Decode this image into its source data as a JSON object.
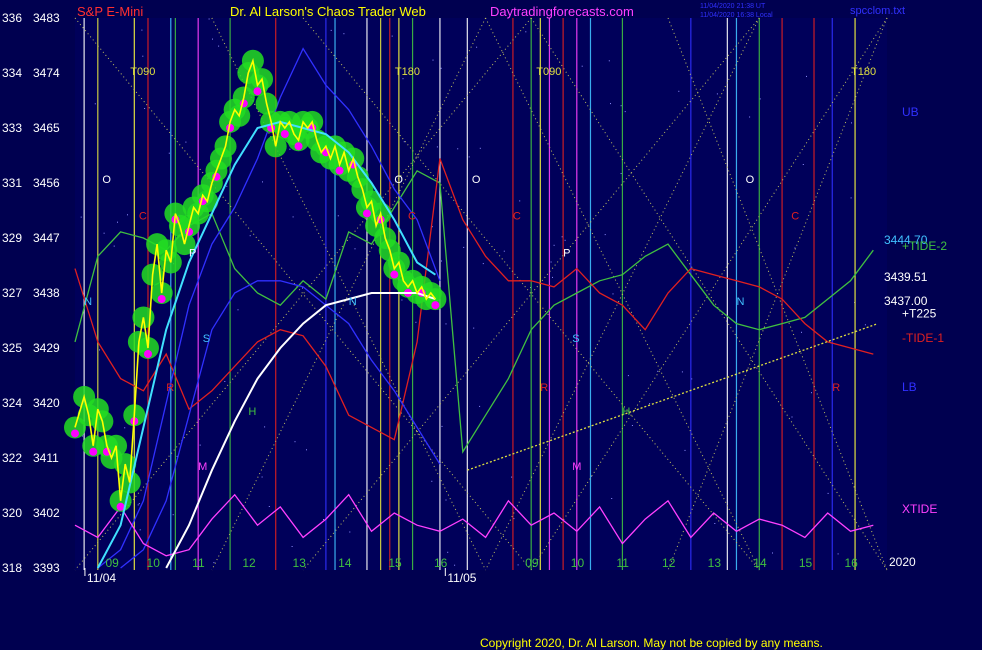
{
  "header": {
    "left_title": "S&P E-Mini",
    "center_title": "Dr. Al Larson's Chaos Trader Web",
    "site": "Daytradingforecasts.com",
    "stamp1": "11/04/2020 21:38 UT",
    "stamp2": "11/04/2020 16:38 Local",
    "filename": "spcclom.txt"
  },
  "footer": {
    "copyright": "Copyright 2020, Dr. Al Larson. May not be copied by any means."
  },
  "colors": {
    "background": "#000050",
    "plot_bg": "#00005a",
    "price": "#ffff00",
    "cyan_ma": "#40e0ff",
    "white_ma": "#ffffff",
    "green_glow": "#22dd22",
    "magenta": "#ff00ff",
    "tide1": "#e02020",
    "tide2": "#40c040",
    "band": "#3030ff"
  },
  "chart_data": {
    "type": "line",
    "ylim": [
      3393,
      3483
    ],
    "y_ticks": [
      {
        "left": "336",
        "right": "3483",
        "v": 3483
      },
      {
        "left": "334",
        "right": "3474",
        "v": 3474
      },
      {
        "left": "333",
        "right": "3465",
        "v": 3465
      },
      {
        "left": "331",
        "right": "3456",
        "v": 3456
      },
      {
        "left": "329",
        "right": "3447",
        "v": 3447
      },
      {
        "left": "327",
        "right": "3438",
        "v": 3438
      },
      {
        "left": "325",
        "right": "3429",
        "v": 3429
      },
      {
        "left": "324",
        "right": "3420",
        "v": 3420
      },
      {
        "left": "322",
        "right": "3411",
        "v": 3411
      },
      {
        "left": "320",
        "right": "3402",
        "v": 3402
      },
      {
        "left": "318",
        "right": "3393",
        "v": 3393
      }
    ],
    "hour_ticks": [
      {
        "label": "09",
        "t": 0.08
      },
      {
        "label": "10",
        "t": 0.17
      },
      {
        "label": "11",
        "t": 0.27
      },
      {
        "label": "12",
        "t": 0.38
      },
      {
        "label": "13",
        "t": 0.49
      },
      {
        "label": "14",
        "t": 0.59
      },
      {
        "label": "15",
        "t": 0.7
      },
      {
        "label": "16",
        "t": 0.8
      },
      {
        "label": "09",
        "t": 1.0
      },
      {
        "label": "10",
        "t": 1.1
      },
      {
        "label": "11",
        "t": 1.2
      },
      {
        "label": "12",
        "t": 1.3
      },
      {
        "label": "13",
        "t": 1.4
      },
      {
        "label": "14",
        "t": 1.5
      },
      {
        "label": "15",
        "t": 1.6
      },
      {
        "label": "16",
        "t": 1.7
      }
    ],
    "date_labels": [
      {
        "label": "11/04",
        "t": 0.07
      },
      {
        "label": "11/05",
        "t": 0.86
      }
    ],
    "year_label": "2020",
    "price": {
      "name": "S&P E-Mini",
      "t": [
        0.0,
        0.02,
        0.03,
        0.04,
        0.05,
        0.06,
        0.07,
        0.08,
        0.09,
        0.1,
        0.11,
        0.12,
        0.13,
        0.14,
        0.15,
        0.16,
        0.17,
        0.18,
        0.19,
        0.2,
        0.21,
        0.22,
        0.23,
        0.24,
        0.25,
        0.26,
        0.27,
        0.28,
        0.29,
        0.3,
        0.31,
        0.32,
        0.33,
        0.34,
        0.35,
        0.36,
        0.37,
        0.38,
        0.39,
        0.4,
        0.41,
        0.42,
        0.43,
        0.44,
        0.45,
        0.46,
        0.47,
        0.48,
        0.49,
        0.5,
        0.51,
        0.52,
        0.53,
        0.54,
        0.55,
        0.56,
        0.57,
        0.58,
        0.59,
        0.6,
        0.61,
        0.62,
        0.63,
        0.64,
        0.65,
        0.66,
        0.67,
        0.68,
        0.69,
        0.7,
        0.71,
        0.72,
        0.73,
        0.74,
        0.75,
        0.76,
        0.77,
        0.78,
        0.79
      ],
      "v": [
        3416,
        3421,
        3418,
        3413,
        3419,
        3417,
        3413,
        3411,
        3413,
        3404,
        3410,
        3407,
        3418,
        3430,
        3434,
        3429,
        3441,
        3446,
        3438,
        3445,
        3443,
        3451,
        3449,
        3446,
        3449,
        3452,
        3451,
        3454,
        3453,
        3456,
        3458,
        3460,
        3462,
        3466,
        3468,
        3467,
        3470,
        3474,
        3476,
        3472,
        3473,
        3469,
        3466,
        3462,
        3466,
        3465,
        3466,
        3464,
        3463,
        3466,
        3465,
        3466,
        3463,
        3461,
        3462,
        3460,
        3462,
        3459,
        3461,
        3458,
        3460,
        3457,
        3455,
        3452,
        3453,
        3449,
        3451,
        3447,
        3445,
        3442,
        3443,
        3440,
        3439,
        3440,
        3438,
        3439,
        3437,
        3438,
        3437
      ]
    },
    "ma_cyan": {
      "t": [
        0.05,
        0.1,
        0.15,
        0.2,
        0.25,
        0.3,
        0.35,
        0.4,
        0.45,
        0.5,
        0.55,
        0.6,
        0.65,
        0.7,
        0.75,
        0.79
      ],
      "v": [
        3393,
        3400,
        3416,
        3432,
        3443,
        3451,
        3459,
        3465,
        3466,
        3465,
        3464,
        3461,
        3456,
        3450,
        3443,
        3441
      ]
    },
    "ma_white": {
      "t": [
        0.2,
        0.25,
        0.3,
        0.35,
        0.4,
        0.45,
        0.5,
        0.55,
        0.6,
        0.65,
        0.7,
        0.75,
        0.79
      ],
      "v": [
        3393,
        3400,
        3409,
        3417,
        3424,
        3429,
        3433,
        3436,
        3437,
        3438,
        3438,
        3438,
        3437
      ]
    },
    "forecasts": [
      {
        "name": "+TIDE-2",
        "color": "#40c040",
        "t": [
          0.0,
          0.05,
          0.1,
          0.15,
          0.2,
          0.25,
          0.3,
          0.35,
          0.4,
          0.45,
          0.5,
          0.55,
          0.6,
          0.65,
          0.7,
          0.75,
          0.8,
          0.85,
          0.9,
          0.95,
          1.0,
          1.05,
          1.1,
          1.15,
          1.2,
          1.25,
          1.3,
          1.35,
          1.4,
          1.45,
          1.5,
          1.55,
          1.6,
          1.65,
          1.7,
          1.75
        ],
        "v": [
          3430,
          3444,
          3448,
          3447,
          3445,
          3449,
          3451,
          3442,
          3438,
          3436,
          3440,
          3437,
          3448,
          3446,
          3452,
          3458,
          3456,
          3412,
          3418,
          3424,
          3432,
          3436,
          3438,
          3440,
          3441,
          3444,
          3446,
          3441,
          3436,
          3433,
          3432,
          3433,
          3434,
          3437,
          3440,
          3445
        ]
      },
      {
        "name": "-TIDE-1",
        "color": "#e02020",
        "t": [
          0.0,
          0.05,
          0.1,
          0.15,
          0.2,
          0.25,
          0.3,
          0.35,
          0.4,
          0.45,
          0.5,
          0.55,
          0.6,
          0.65,
          0.7,
          0.75,
          0.8,
          0.85,
          0.9,
          0.95,
          1.0,
          1.05,
          1.1,
          1.15,
          1.2,
          1.25,
          1.3,
          1.35,
          1.4,
          1.45,
          1.5,
          1.55,
          1.6,
          1.65,
          1.7,
          1.75
        ],
        "v": [
          3442,
          3430,
          3424,
          3422,
          3428,
          3419,
          3422,
          3426,
          3430,
          3432,
          3431,
          3426,
          3418,
          3416,
          3414,
          3430,
          3460,
          3450,
          3444,
          3440,
          3440,
          3439,
          3442,
          3438,
          3436,
          3432,
          3438,
          3442,
          3441,
          3440,
          3439,
          3437,
          3433,
          3430,
          3429,
          3428
        ]
      },
      {
        "name": "UB",
        "color": "#3030ff",
        "t": [
          0.05,
          0.1,
          0.15,
          0.2,
          0.25,
          0.3,
          0.35,
          0.4,
          0.45,
          0.5,
          0.55,
          0.6,
          0.65,
          0.7,
          0.75,
          0.8
        ],
        "v": [
          3393,
          3396,
          3404,
          3420,
          3436,
          3446,
          3452,
          3460,
          3470,
          3478,
          3472,
          3468,
          3462,
          3455,
          3450,
          3440
        ]
      },
      {
        "name": "LB",
        "color": "#3030ff",
        "t": [
          0.1,
          0.15,
          0.2,
          0.25,
          0.3,
          0.35,
          0.4,
          0.45,
          0.5,
          0.55,
          0.6,
          0.65,
          0.7,
          0.75,
          0.8
        ],
        "v": [
          3393,
          3396,
          3404,
          3418,
          3432,
          3438,
          3440,
          3440,
          3439,
          3436,
          3433,
          3427,
          3422,
          3416,
          3410
        ]
      },
      {
        "name": "XTIDE",
        "color": "#ff40ff",
        "t": [
          0.0,
          0.05,
          0.1,
          0.15,
          0.2,
          0.25,
          0.3,
          0.35,
          0.4,
          0.45,
          0.5,
          0.55,
          0.6,
          0.65,
          0.7,
          0.75,
          0.8,
          0.85,
          0.9,
          0.95,
          1.0,
          1.05,
          1.1,
          1.15,
          1.2,
          1.25,
          1.3,
          1.35,
          1.4,
          1.45,
          1.5,
          1.55,
          1.6,
          1.65,
          1.7,
          1.75
        ],
        "v": [
          3400,
          3398,
          3403,
          3397,
          3395,
          3396,
          3401,
          3405,
          3400,
          3403,
          3398,
          3401,
          3405,
          3399,
          3402,
          3400,
          3399,
          3401,
          3398,
          3404,
          3400,
          3402,
          3399,
          3403,
          3397,
          3401,
          3404,
          3398,
          3402,
          3399,
          3401,
          3400,
          3398,
          3402,
          3399,
          3400
        ]
      },
      {
        "name": "+T225",
        "color": "#e0e040",
        "t": [
          0.86,
          1.76
        ],
        "v": [
          3409,
          3433
        ]
      }
    ],
    "flow_lines": [
      {
        "label": "T090",
        "t": 0.13,
        "color": "#e0e040"
      },
      {
        "label": "T180",
        "t": 0.71,
        "color": "#e0e040"
      },
      {
        "label": "T090",
        "t": 1.02,
        "color": "#e0e040"
      },
      {
        "label": "T180",
        "t": 1.71,
        "color": "#e0e040"
      }
    ],
    "letter_markers": [
      {
        "label": "O",
        "t": 0.06,
        "v": 3456,
        "color": "#ffffff"
      },
      {
        "label": "C",
        "t": 0.14,
        "v": 3450,
        "color": "#e02020"
      },
      {
        "label": "P",
        "t": 0.25,
        "v": 3444,
        "color": "#ffffff"
      },
      {
        "label": "N",
        "t": 0.02,
        "v": 3436,
        "color": "#40c0ff"
      },
      {
        "label": "S",
        "t": 0.28,
        "v": 3430,
        "color": "#40c0ff"
      },
      {
        "label": "R",
        "t": 0.2,
        "v": 3422,
        "color": "#e02020"
      },
      {
        "label": "H",
        "t": 0.38,
        "v": 3418,
        "color": "#40c040"
      },
      {
        "label": "M",
        "t": 0.27,
        "v": 3409,
        "color": "#ff40ff"
      },
      {
        "label": "N",
        "t": 0.6,
        "v": 3436,
        "color": "#40c0ff"
      },
      {
        "label": "O",
        "t": 0.7,
        "v": 3456,
        "color": "#ffffff"
      },
      {
        "label": "C",
        "t": 0.73,
        "v": 3450,
        "color": "#e02020"
      },
      {
        "label": "O",
        "t": 0.87,
        "v": 3456,
        "color": "#ffffff"
      },
      {
        "label": "C",
        "t": 0.96,
        "v": 3450,
        "color": "#e02020"
      },
      {
        "label": "P",
        "t": 1.07,
        "v": 3444,
        "color": "#ffffff"
      },
      {
        "label": "S",
        "t": 1.09,
        "v": 3430,
        "color": "#40c0ff"
      },
      {
        "label": "R",
        "t": 1.02,
        "v": 3422,
        "color": "#e02020"
      },
      {
        "label": "H",
        "t": 1.2,
        "v": 3418,
        "color": "#40c040"
      },
      {
        "label": "M",
        "t": 1.09,
        "v": 3409,
        "color": "#ff40ff"
      },
      {
        "label": "N",
        "t": 1.45,
        "v": 3436,
        "color": "#40c0ff"
      },
      {
        "label": "O",
        "t": 1.47,
        "v": 3456,
        "color": "#ffffff"
      },
      {
        "label": "C",
        "t": 1.57,
        "v": 3450,
        "color": "#e02020"
      },
      {
        "label": "R",
        "t": 1.66,
        "v": 3422,
        "color": "#e02020"
      }
    ],
    "vertical_lines": [
      {
        "t": 0.02,
        "color": "#ffffff"
      },
      {
        "t": 0.05,
        "color": "#e0e040"
      },
      {
        "t": 0.16,
        "color": "#e02020"
      },
      {
        "t": 0.21,
        "color": "#40c0ff"
      },
      {
        "t": 0.22,
        "color": "#40c040"
      },
      {
        "t": 0.27,
        "color": "#ff40ff"
      },
      {
        "t": 0.34,
        "color": "#40c040"
      },
      {
        "t": 0.44,
        "color": "#e02020"
      },
      {
        "t": 0.55,
        "color": "#3030ff"
      },
      {
        "t": 0.57,
        "color": "#40c0ff"
      },
      {
        "t": 0.64,
        "color": "#ffffff"
      },
      {
        "t": 0.67,
        "color": "#e0e040"
      },
      {
        "t": 0.69,
        "color": "#e02020"
      },
      {
        "t": 0.74,
        "color": "#40c040"
      },
      {
        "t": 0.8,
        "color": "#ffffff"
      },
      {
        "t": 0.86,
        "color": "#ffffff"
      },
      {
        "t": 0.96,
        "color": "#e02020"
      },
      {
        "t": 1.0,
        "color": "#40c040"
      },
      {
        "t": 1.04,
        "color": "#ff40ff"
      },
      {
        "t": 1.07,
        "color": "#e02020"
      },
      {
        "t": 1.1,
        "color": "#ff40ff"
      },
      {
        "t": 1.13,
        "color": "#40c0ff"
      },
      {
        "t": 1.2,
        "color": "#40c040"
      },
      {
        "t": 1.35,
        "color": "#3030ff"
      },
      {
        "t": 1.43,
        "color": "#ffffff"
      },
      {
        "t": 1.45,
        "color": "#40c0ff"
      },
      {
        "t": 1.5,
        "color": "#40c040"
      },
      {
        "t": 1.55,
        "color": "#e02020"
      },
      {
        "t": 1.62,
        "color": "#e02020"
      },
      {
        "t": 1.66,
        "color": "#3030ff"
      }
    ],
    "value_labels": [
      {
        "text": "3444.70",
        "v": 3446,
        "color": "#40c0ff"
      },
      {
        "text": "3439.51",
        "v": 3440,
        "color": "#ffffff"
      },
      {
        "text": "3437.00",
        "v": 3436,
        "color": "#ffffff"
      }
    ],
    "right_labels": [
      {
        "text": "UB",
        "v": 3467,
        "color": "#3030ff"
      },
      {
        "text": "+TIDE-2",
        "v": 3445,
        "color": "#40c040"
      },
      {
        "text": "+T225",
        "v": 3434,
        "color": "#ffffff"
      },
      {
        "text": "-TIDE-1",
        "v": 3430,
        "color": "#e02020"
      },
      {
        "text": "LB",
        "v": 3422,
        "color": "#3030ff"
      },
      {
        "text": "XTIDE",
        "v": 3402,
        "color": "#ff40ff"
      }
    ]
  }
}
